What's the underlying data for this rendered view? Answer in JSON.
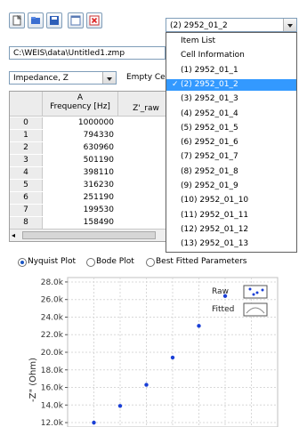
{
  "toolbar": {
    "icons": [
      "new-file-icon",
      "open-folder-icon",
      "save-icon",
      "window-icon",
      "close-icon"
    ]
  },
  "file_combo": {
    "selected": "(2) 2952_01_2"
  },
  "path": "C:\\WEIS\\data\\Untitled1.zmp",
  "impedance_combo": {
    "selected": "Impedance, Z"
  },
  "empty_label": "Empty Ce",
  "grid": {
    "col_a_letter": "A",
    "col_a_header": "Frequency [Hz]",
    "col_b_header": "Z'_raw",
    "rows": [
      {
        "idx": "0",
        "freq": "1000000",
        "z": ""
      },
      {
        "idx": "1",
        "freq": "794330",
        "z": ""
      },
      {
        "idx": "2",
        "freq": "630960",
        "z": "1"
      },
      {
        "idx": "3",
        "freq": "501190",
        "z": ""
      },
      {
        "idx": "4",
        "freq": "398110",
        "z": "1"
      },
      {
        "idx": "5",
        "freq": "316230",
        "z": "1"
      },
      {
        "idx": "6",
        "freq": "251190",
        "z": "1"
      },
      {
        "idx": "7",
        "freq": "199530",
        "z": "1"
      },
      {
        "idx": "8",
        "freq": "158490",
        "z": "1"
      }
    ]
  },
  "dropdown": {
    "items": [
      {
        "label": "Item List",
        "selected": false,
        "check": false
      },
      {
        "label": "Cell Information",
        "selected": false,
        "check": false
      },
      {
        "label": "(1) 2952_01_1",
        "selected": false,
        "check": false
      },
      {
        "label": "(2) 2952_01_2",
        "selected": true,
        "check": true
      },
      {
        "label": "(3) 2952_01_3",
        "selected": false,
        "check": false
      },
      {
        "label": "(4) 2952_01_4",
        "selected": false,
        "check": false
      },
      {
        "label": "(5) 2952_01_5",
        "selected": false,
        "check": false
      },
      {
        "label": "(6) 2952_01_6",
        "selected": false,
        "check": false
      },
      {
        "label": "(7) 2952_01_7",
        "selected": false,
        "check": false
      },
      {
        "label": "(8) 2952_01_8",
        "selected": false,
        "check": false
      },
      {
        "label": "(9) 2952_01_9",
        "selected": false,
        "check": false
      },
      {
        "label": "(10) 2952_01_10",
        "selected": false,
        "check": false
      },
      {
        "label": "(11) 2952_01_11",
        "selected": false,
        "check": false
      },
      {
        "label": "(12) 2952_01_12",
        "selected": false,
        "check": false
      },
      {
        "label": "(13) 2952_01_13",
        "selected": false,
        "check": false
      }
    ]
  },
  "radios": [
    {
      "label": "Nyquist Plot",
      "checked": true
    },
    {
      "label": "Bode Plot",
      "checked": false
    },
    {
      "label": "Best Fitted Parameters",
      "checked": false
    }
  ],
  "colors": {
    "accent": "#3399ff",
    "point": "#1a3fd6",
    "grid_line": "#d8d8d8"
  },
  "chart_data": {
    "type": "scatter",
    "ylabel": "-Z\" (Ohm)",
    "ylim": [
      11.5,
      28.5
    ],
    "yticks": [
      "28.0k",
      "26.0k",
      "24.0k",
      "22.0k",
      "20.0k",
      "18.0k",
      "16.0k",
      "14.0k",
      "12.0k"
    ],
    "grid": true,
    "legend": {
      "placement": "top-right",
      "entries": [
        "Raw",
        "Fitted"
      ]
    },
    "series": [
      {
        "name": "Raw",
        "points": [
          {
            "x": 1,
            "y": 12.0
          },
          {
            "x": 2,
            "y": 13.9
          },
          {
            "x": 3,
            "y": 16.3
          },
          {
            "x": 4,
            "y": 19.4
          },
          {
            "x": 5,
            "y": 23.0
          },
          {
            "x": 6,
            "y": 26.4
          },
          {
            "x": 7,
            "y": 26.9
          }
        ]
      }
    ]
  }
}
